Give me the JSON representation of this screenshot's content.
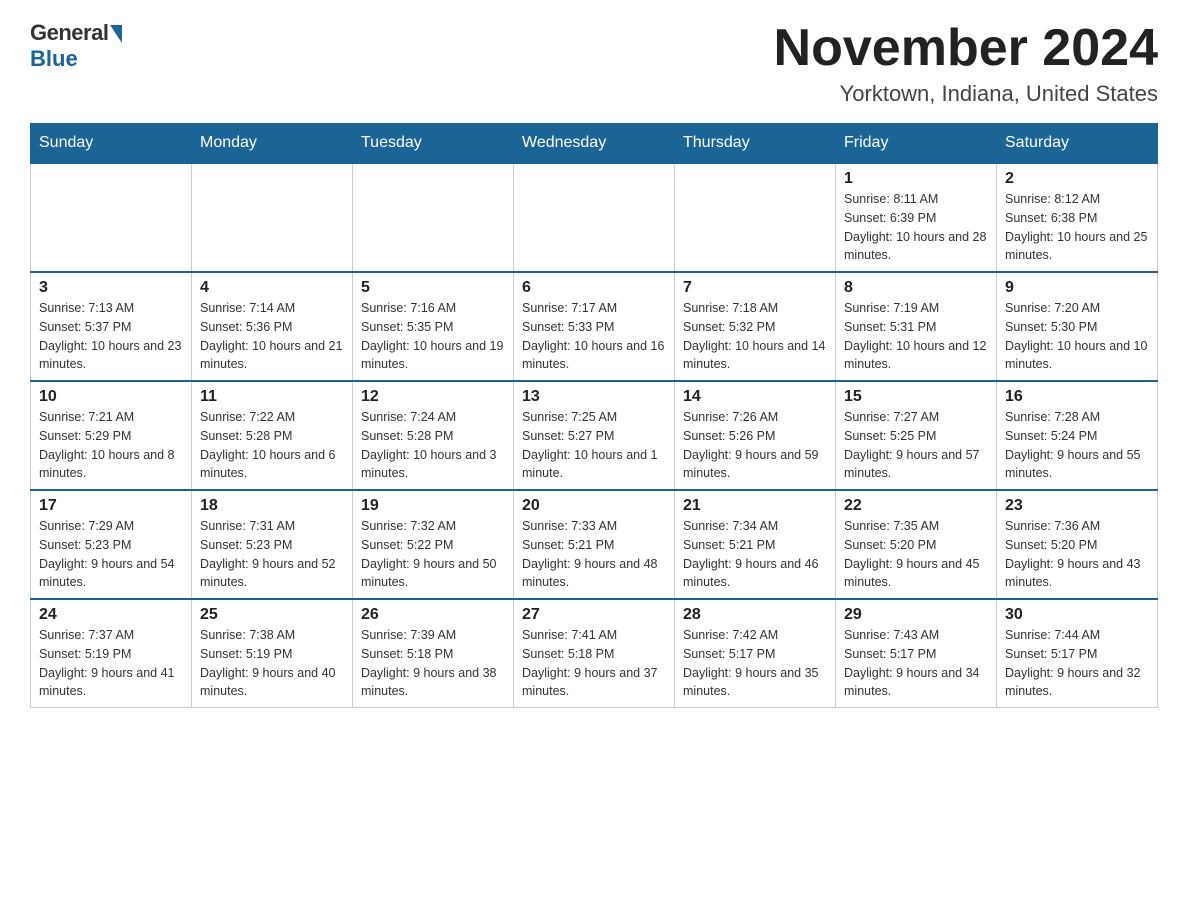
{
  "logo": {
    "general": "General",
    "blue": "Blue"
  },
  "header": {
    "month_year": "November 2024",
    "location": "Yorktown, Indiana, United States"
  },
  "days_of_week": [
    "Sunday",
    "Monday",
    "Tuesday",
    "Wednesday",
    "Thursday",
    "Friday",
    "Saturday"
  ],
  "weeks": [
    [
      {
        "day": "",
        "info": ""
      },
      {
        "day": "",
        "info": ""
      },
      {
        "day": "",
        "info": ""
      },
      {
        "day": "",
        "info": ""
      },
      {
        "day": "",
        "info": ""
      },
      {
        "day": "1",
        "info": "Sunrise: 8:11 AM\nSunset: 6:39 PM\nDaylight: 10 hours and 28 minutes."
      },
      {
        "day": "2",
        "info": "Sunrise: 8:12 AM\nSunset: 6:38 PM\nDaylight: 10 hours and 25 minutes."
      }
    ],
    [
      {
        "day": "3",
        "info": "Sunrise: 7:13 AM\nSunset: 5:37 PM\nDaylight: 10 hours and 23 minutes."
      },
      {
        "day": "4",
        "info": "Sunrise: 7:14 AM\nSunset: 5:36 PM\nDaylight: 10 hours and 21 minutes."
      },
      {
        "day": "5",
        "info": "Sunrise: 7:16 AM\nSunset: 5:35 PM\nDaylight: 10 hours and 19 minutes."
      },
      {
        "day": "6",
        "info": "Sunrise: 7:17 AM\nSunset: 5:33 PM\nDaylight: 10 hours and 16 minutes."
      },
      {
        "day": "7",
        "info": "Sunrise: 7:18 AM\nSunset: 5:32 PM\nDaylight: 10 hours and 14 minutes."
      },
      {
        "day": "8",
        "info": "Sunrise: 7:19 AM\nSunset: 5:31 PM\nDaylight: 10 hours and 12 minutes."
      },
      {
        "day": "9",
        "info": "Sunrise: 7:20 AM\nSunset: 5:30 PM\nDaylight: 10 hours and 10 minutes."
      }
    ],
    [
      {
        "day": "10",
        "info": "Sunrise: 7:21 AM\nSunset: 5:29 PM\nDaylight: 10 hours and 8 minutes."
      },
      {
        "day": "11",
        "info": "Sunrise: 7:22 AM\nSunset: 5:28 PM\nDaylight: 10 hours and 6 minutes."
      },
      {
        "day": "12",
        "info": "Sunrise: 7:24 AM\nSunset: 5:28 PM\nDaylight: 10 hours and 3 minutes."
      },
      {
        "day": "13",
        "info": "Sunrise: 7:25 AM\nSunset: 5:27 PM\nDaylight: 10 hours and 1 minute."
      },
      {
        "day": "14",
        "info": "Sunrise: 7:26 AM\nSunset: 5:26 PM\nDaylight: 9 hours and 59 minutes."
      },
      {
        "day": "15",
        "info": "Sunrise: 7:27 AM\nSunset: 5:25 PM\nDaylight: 9 hours and 57 minutes."
      },
      {
        "day": "16",
        "info": "Sunrise: 7:28 AM\nSunset: 5:24 PM\nDaylight: 9 hours and 55 minutes."
      }
    ],
    [
      {
        "day": "17",
        "info": "Sunrise: 7:29 AM\nSunset: 5:23 PM\nDaylight: 9 hours and 54 minutes."
      },
      {
        "day": "18",
        "info": "Sunrise: 7:31 AM\nSunset: 5:23 PM\nDaylight: 9 hours and 52 minutes."
      },
      {
        "day": "19",
        "info": "Sunrise: 7:32 AM\nSunset: 5:22 PM\nDaylight: 9 hours and 50 minutes."
      },
      {
        "day": "20",
        "info": "Sunrise: 7:33 AM\nSunset: 5:21 PM\nDaylight: 9 hours and 48 minutes."
      },
      {
        "day": "21",
        "info": "Sunrise: 7:34 AM\nSunset: 5:21 PM\nDaylight: 9 hours and 46 minutes."
      },
      {
        "day": "22",
        "info": "Sunrise: 7:35 AM\nSunset: 5:20 PM\nDaylight: 9 hours and 45 minutes."
      },
      {
        "day": "23",
        "info": "Sunrise: 7:36 AM\nSunset: 5:20 PM\nDaylight: 9 hours and 43 minutes."
      }
    ],
    [
      {
        "day": "24",
        "info": "Sunrise: 7:37 AM\nSunset: 5:19 PM\nDaylight: 9 hours and 41 minutes."
      },
      {
        "day": "25",
        "info": "Sunrise: 7:38 AM\nSunset: 5:19 PM\nDaylight: 9 hours and 40 minutes."
      },
      {
        "day": "26",
        "info": "Sunrise: 7:39 AM\nSunset: 5:18 PM\nDaylight: 9 hours and 38 minutes."
      },
      {
        "day": "27",
        "info": "Sunrise: 7:41 AM\nSunset: 5:18 PM\nDaylight: 9 hours and 37 minutes."
      },
      {
        "day": "28",
        "info": "Sunrise: 7:42 AM\nSunset: 5:17 PM\nDaylight: 9 hours and 35 minutes."
      },
      {
        "day": "29",
        "info": "Sunrise: 7:43 AM\nSunset: 5:17 PM\nDaylight: 9 hours and 34 minutes."
      },
      {
        "day": "30",
        "info": "Sunrise: 7:44 AM\nSunset: 5:17 PM\nDaylight: 9 hours and 32 minutes."
      }
    ]
  ]
}
